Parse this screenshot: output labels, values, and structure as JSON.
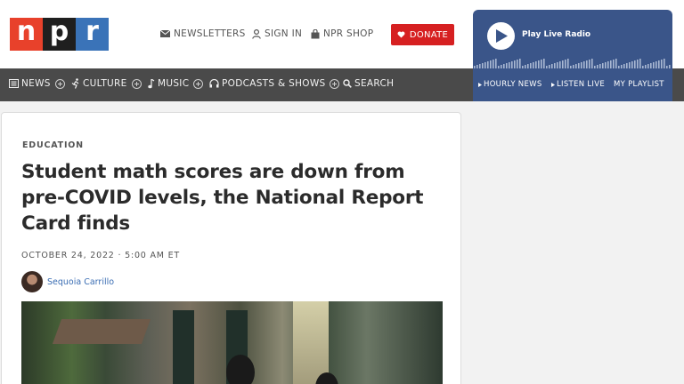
{
  "logo": {
    "letters": [
      "n",
      "p",
      "r"
    ]
  },
  "utility": {
    "newsletters": "NEWSLETTERS",
    "sign_in": "SIGN IN",
    "shop": "NPR SHOP",
    "donate": "DONATE"
  },
  "live_radio": {
    "label": "Play Live Radio"
  },
  "nav": {
    "items": [
      {
        "label": "NEWS",
        "icon": "news-icon"
      },
      {
        "label": "CULTURE",
        "icon": "culture-icon"
      },
      {
        "label": "MUSIC",
        "icon": "music-note-icon"
      },
      {
        "label": "PODCASTS & SHOWS",
        "icon": "headphones-icon"
      },
      {
        "label": "SEARCH",
        "icon": "search-icon"
      }
    ]
  },
  "radio_nav": {
    "hourly": "HOURLY NEWS",
    "listen": "LISTEN LIVE",
    "playlist": "MY PLAYLIST"
  },
  "article": {
    "section": "EDUCATION",
    "headline": "Student math scores are down from pre-COVID levels, the National Report Card finds",
    "date": "OCTOBER 24, 2022 · 5:00 AM ET",
    "author": "Sequoia Carrillo"
  },
  "colors": {
    "brand_red": "#e8412b",
    "brand_blue": "#3a73b8",
    "donate_red": "#d62021",
    "nav_gray": "#4a4a4a",
    "radio_blue": "#3a5589",
    "link_blue": "#3a6db3"
  }
}
